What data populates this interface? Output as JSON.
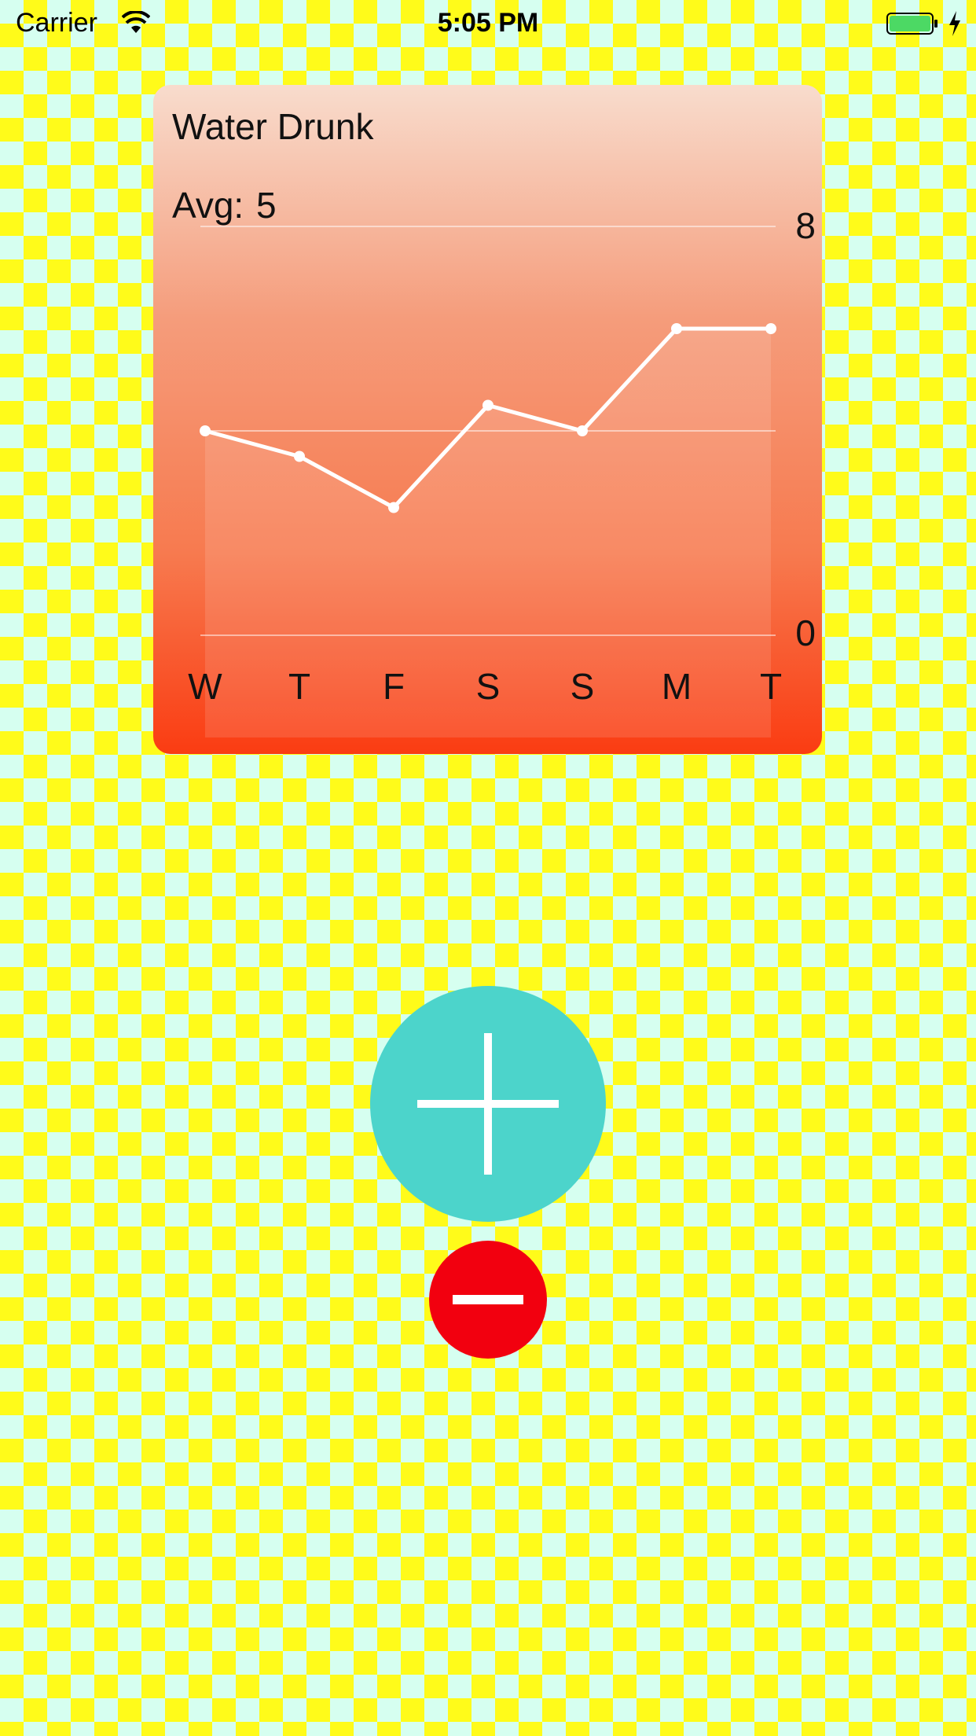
{
  "status_bar": {
    "carrier": "Carrier",
    "time": "5:05 PM",
    "battery_color": "#4cd964"
  },
  "graph": {
    "title": "Water Drunk",
    "avg_label": "Avg:",
    "avg_value": "5",
    "max_label": "8",
    "min_label": "0",
    "colors": {
      "gradient_top": "#f8dccd",
      "gradient_bottom": "#fa3c12",
      "line": "#ffffff"
    }
  },
  "chart_data": {
    "type": "line",
    "categories": [
      "W",
      "T",
      "F",
      "S",
      "S",
      "M",
      "T"
    ],
    "values": [
      4,
      3.5,
      2.5,
      4.5,
      4,
      6,
      6
    ],
    "ylim": [
      0,
      8
    ],
    "grid": true,
    "title": "Water Drunk"
  },
  "buttons": {
    "add": {
      "icon": "plus-icon",
      "color": "#4cd4cb"
    },
    "subtract": {
      "icon": "minus-icon",
      "color": "#f2000f"
    }
  }
}
